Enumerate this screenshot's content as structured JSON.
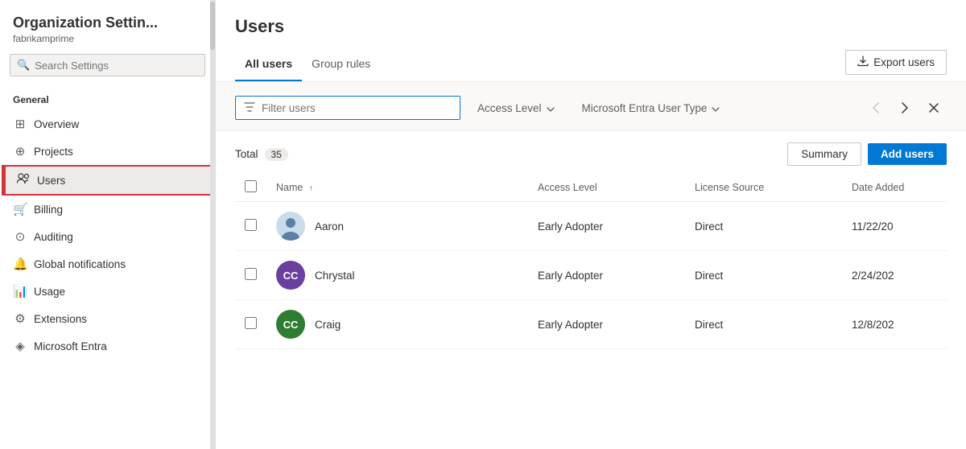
{
  "sidebar": {
    "title": "Organization Settin...",
    "subtitle": "fabrikamprime",
    "search": {
      "placeholder": "Search Settings"
    },
    "sections": [
      {
        "label": "General",
        "items": [
          {
            "id": "overview",
            "label": "Overview",
            "icon": "⊞"
          },
          {
            "id": "projects",
            "label": "Projects",
            "icon": "⊕"
          },
          {
            "id": "users",
            "label": "Users",
            "icon": "👥",
            "active": true
          },
          {
            "id": "billing",
            "label": "Billing",
            "icon": "🛒"
          },
          {
            "id": "auditing",
            "label": "Auditing",
            "icon": "⊙"
          },
          {
            "id": "global-notifications",
            "label": "Global notifications",
            "icon": "🔔"
          },
          {
            "id": "usage",
            "label": "Usage",
            "icon": "📊"
          },
          {
            "id": "extensions",
            "label": "Extensions",
            "icon": "⚙"
          },
          {
            "id": "microsoft-entra",
            "label": "Microsoft Entra",
            "icon": "◈"
          }
        ]
      }
    ]
  },
  "main": {
    "title": "Users",
    "tabs": [
      {
        "id": "all-users",
        "label": "All users",
        "active": true
      },
      {
        "id": "group-rules",
        "label": "Group rules",
        "active": false
      }
    ],
    "export_button": "Export users",
    "filter": {
      "placeholder": "Filter users",
      "icon": "filter"
    },
    "dropdowns": [
      {
        "id": "access-level",
        "label": "Access Level"
      },
      {
        "id": "entra-user-type",
        "label": "Microsoft Entra User Type"
      }
    ],
    "total_label": "Total",
    "total_count": "35",
    "summary_button": "Summary",
    "add_users_button": "Add users",
    "table": {
      "columns": [
        {
          "id": "name",
          "label": "Name",
          "sort": "asc"
        },
        {
          "id": "access-level",
          "label": "Access Level"
        },
        {
          "id": "license-source",
          "label": "License Source"
        },
        {
          "id": "date-added",
          "label": "Date Added"
        }
      ],
      "rows": [
        {
          "id": "aaron",
          "name": "Aaron",
          "access_level": "Early Adopter",
          "license_source": "Direct",
          "date_added": "11/22/20",
          "avatar_type": "photo",
          "avatar_initials": "",
          "avatar_color": "#c0d8ea"
        },
        {
          "id": "chrystal",
          "name": "Chrystal",
          "access_level": "Early Adopter",
          "license_source": "Direct",
          "date_added": "2/24/202",
          "avatar_type": "initials",
          "avatar_initials": "CC",
          "avatar_color": "#6b3fa0"
        },
        {
          "id": "craig",
          "name": "Craig",
          "access_level": "Early Adopter",
          "license_source": "Direct",
          "date_added": "12/8/202",
          "avatar_type": "initials",
          "avatar_initials": "CC",
          "avatar_color": "#2e7d32"
        }
      ]
    }
  }
}
